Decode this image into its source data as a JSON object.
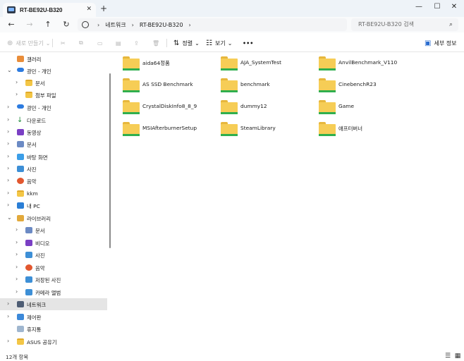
{
  "window": {
    "tab_title": "RT-BE92U-B320",
    "tab_close": "✕",
    "new_tab": "+",
    "minimize": "—",
    "maximize": "☐",
    "close": "✕"
  },
  "nav": {
    "back": "←",
    "forward": "→",
    "up": "↑",
    "refresh": "↻",
    "breadcrumbs": [
      "네트워크",
      "RT-BE92U-B320"
    ],
    "crumb_separator": "›",
    "search_placeholder": "RT-BE92U-B320 검색",
    "search_icon": "search-icon"
  },
  "toolbar": {
    "new_label": "새로 만들기",
    "sort_label": "정렬",
    "view_label": "보기",
    "more_label": "•••",
    "details_label": "세부 정보"
  },
  "sidebar": {
    "items": [
      {
        "label": "갤러리",
        "icon": "gallery-icon"
      },
      {
        "label": "광민 - 개인",
        "icon": "cloud-icon"
      },
      {
        "label": "문서",
        "icon": "folder-icon"
      },
      {
        "label": "첨부 파일",
        "icon": "folder-icon"
      },
      {
        "label": "광민 - 개인",
        "icon": "cloud-icon"
      },
      {
        "label": "다운로드",
        "icon": "download-icon"
      },
      {
        "label": "동영상",
        "icon": "video-icon"
      },
      {
        "label": "문서",
        "icon": "document-icon"
      },
      {
        "label": "바탕 화면",
        "icon": "desktop-icon"
      },
      {
        "label": "사진",
        "icon": "picture-icon"
      },
      {
        "label": "음악",
        "icon": "music-icon"
      },
      {
        "label": "kkm",
        "icon": "folder-icon"
      },
      {
        "label": "내 PC",
        "icon": "pc-icon"
      },
      {
        "label": "라이브러리",
        "icon": "library-icon"
      },
      {
        "label": "문서",
        "icon": "document-icon"
      },
      {
        "label": "비디오",
        "icon": "video-icon"
      },
      {
        "label": "사진",
        "icon": "picture-icon"
      },
      {
        "label": "음악",
        "icon": "music-icon"
      },
      {
        "label": "저장된 사진",
        "icon": "picture-icon"
      },
      {
        "label": "카메라 앨범",
        "icon": "picture-icon"
      },
      {
        "label": "네트워크",
        "icon": "network-icon"
      },
      {
        "label": "제어판",
        "icon": "control-panel-icon"
      },
      {
        "label": "휴지통",
        "icon": "recycle-bin-icon"
      },
      {
        "label": "ASUS 공유기",
        "icon": "folder-icon"
      }
    ]
  },
  "content": {
    "folders": [
      "aida64정품",
      "AJA_SystemTest",
      "AnvilBenchmark_V110",
      "AS SSD Benchmark",
      "benchmark",
      "CinebenchR23",
      "CrystalDiskInfo8_8_9",
      "dummy12",
      "Game",
      "MSIAfterburnerSetup",
      "SteamLibrary",
      "애프터버너"
    ]
  },
  "status": {
    "item_count": "12개 항목"
  },
  "colors": {
    "folder": "#f6cd56",
    "folder_bar": "#2faf4e",
    "selected": "#e5e5e5"
  }
}
